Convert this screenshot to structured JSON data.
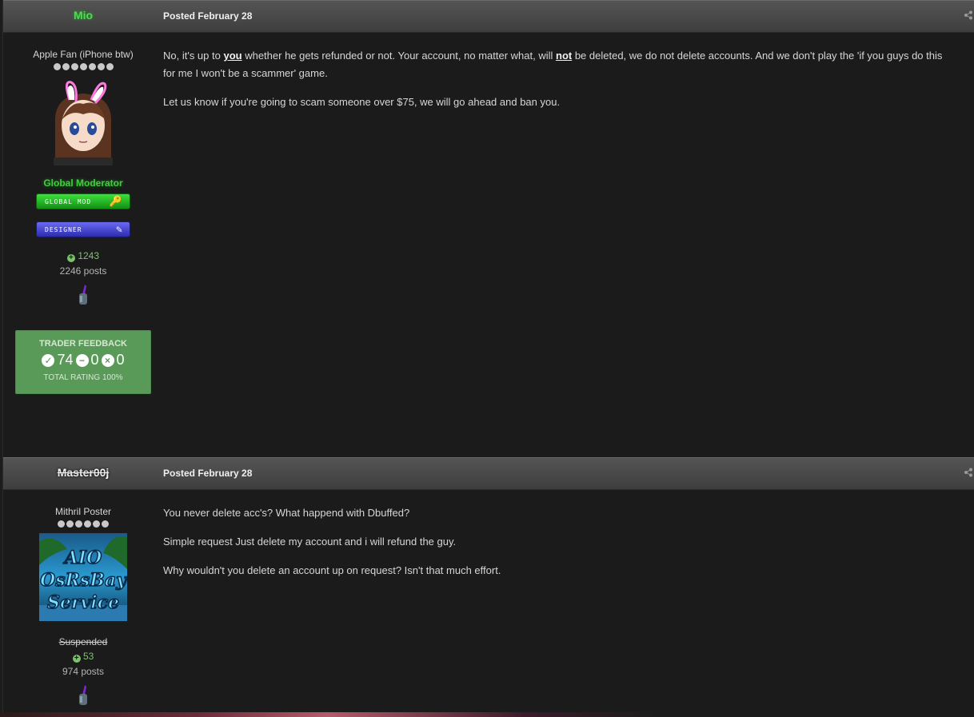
{
  "posts": [
    {
      "username": "Mio",
      "posted": "Posted February 28",
      "user_title": "Apple Fan (iPhone btw)",
      "pips": 7,
      "group": "Global Moderator",
      "badges": [
        "GLOBAL MOD",
        "DESIGNER"
      ],
      "reputation": "1243",
      "posts_count": "2246 posts",
      "trader_feedback": {
        "title": "TRADER FEEDBACK",
        "positive": "74",
        "neutral": "0",
        "negative": "0",
        "total": "TOTAL RATING 100%"
      },
      "content_parts": {
        "p1_a": "No, it's up to ",
        "p1_you": "you",
        "p1_b": " whether he gets refunded or not. Your account, no matter what, will ",
        "p1_not": "not",
        "p1_c": " be deleted, we do not delete accounts. And we don't play the 'if you guys do this for me I won't be a scammer' game.",
        "p2": "Let us know if you're going to scam someone over $75, we will go ahead and ban you."
      }
    },
    {
      "username": "Master00j",
      "posted": "Posted February 28",
      "user_title": "Mithril Poster",
      "pips": 6,
      "avatar_text": [
        "AIO",
        "OsRsBay",
        "Service"
      ],
      "status": "Suspended",
      "reputation": "53",
      "posts_count": "974 posts",
      "content": [
        "You never delete acc's? What happend with Dbuffed?",
        "Simple request Just delete my account and i will refund the guy.",
        "Why wouldn't you delete an account up on request? Isn't that much effort."
      ]
    }
  ],
  "colors": {
    "header": "#4a4a4a",
    "background": "#1b1b1b",
    "moderator_green": "#46e04a",
    "feedback_green": "#5a9a58",
    "reputation_green": "#7bc46c"
  },
  "icons": [
    "share-icon",
    "plus-icon",
    "check-icon",
    "minus-icon",
    "x-icon",
    "key-icon",
    "pencil-icon",
    "rank-icon"
  ]
}
